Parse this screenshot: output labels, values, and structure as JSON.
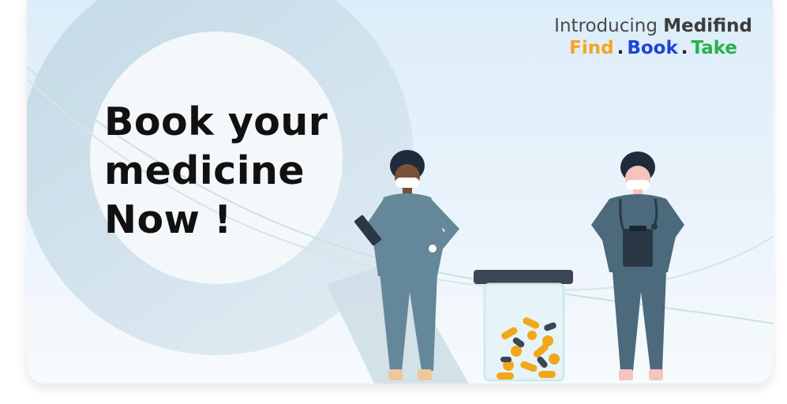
{
  "headline": {
    "line1": "Book your",
    "line2": "medicine",
    "line3": "Now !"
  },
  "intro": {
    "prefix": "Introducing",
    "brand": "Medifind"
  },
  "tagline": {
    "find": "Find",
    "book": "Book",
    "take": "Take",
    "separator": "."
  },
  "colors": {
    "find": "#f7a422",
    "book": "#2143d8",
    "take": "#27b24a",
    "scrubs": "#64879a",
    "scrubs_dark": "#4b6a7c",
    "pills": "#f0a81c"
  },
  "illustration": {
    "left_figure": "doctor-with-tablet-icon",
    "right_figure": "nurse-with-clipboard-icon",
    "jar": "pill-jar-icon"
  }
}
